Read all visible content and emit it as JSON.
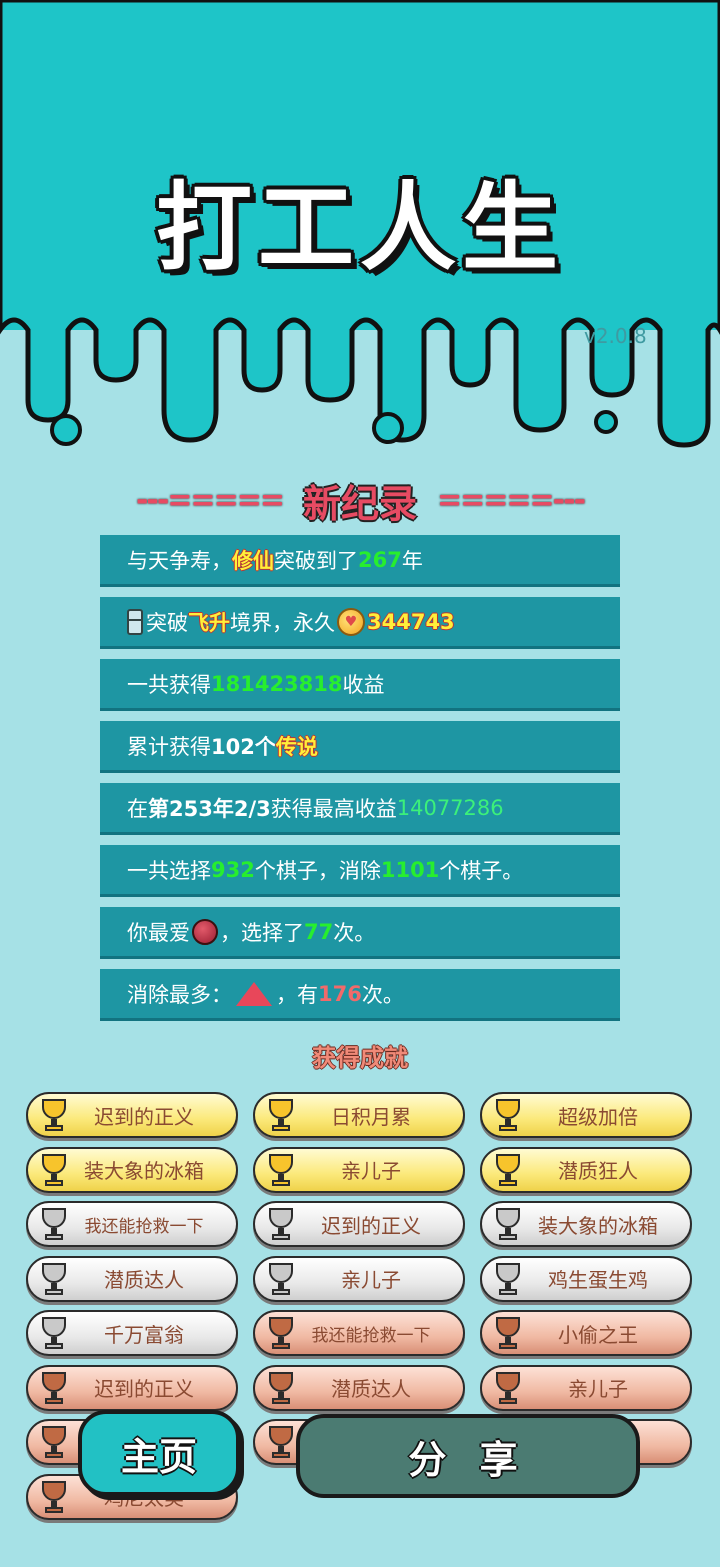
{
  "header": {
    "title": "打工人生",
    "version": "v2.0.8"
  },
  "record": {
    "label": "新纪录",
    "deco_left": "---=====",
    "deco_right": "=====---"
  },
  "stats": [
    {
      "parts": [
        "与天争寿，",
        "修仙",
        "突破到了",
        "267",
        "年"
      ]
    },
    {
      "parts": [
        "突破",
        "飞升",
        "境界，永久",
        "344743"
      ]
    },
    {
      "parts": [
        "一共获得",
        "181423818",
        "收益"
      ]
    },
    {
      "parts": [
        "累计获得",
        "102个",
        "传说"
      ]
    },
    {
      "parts": [
        "在 ",
        "第253年2/3",
        " 获得最高收益",
        "14077286"
      ]
    },
    {
      "parts": [
        "一共选择",
        "932",
        "个棋子，消除",
        "1101",
        "个棋子。"
      ]
    },
    {
      "parts": [
        "你最爱",
        "，选择了",
        "77",
        "次。"
      ]
    },
    {
      "parts": [
        "消除最多：",
        "，有",
        "176",
        "次。"
      ]
    }
  ],
  "achievements": {
    "title": "获得成就",
    "items": [
      {
        "label": "迟到的正义",
        "tier": "gold"
      },
      {
        "label": "日积月累",
        "tier": "gold"
      },
      {
        "label": "超级加倍",
        "tier": "gold"
      },
      {
        "label": "装大象的冰箱",
        "tier": "gold"
      },
      {
        "label": "亲儿子",
        "tier": "gold"
      },
      {
        "label": "潜质狂人",
        "tier": "gold"
      },
      {
        "label": "我还能抢救一下",
        "tier": "silver"
      },
      {
        "label": "迟到的正义",
        "tier": "silver"
      },
      {
        "label": "装大象的冰箱",
        "tier": "silver"
      },
      {
        "label": "潜质达人",
        "tier": "silver"
      },
      {
        "label": "亲儿子",
        "tier": "silver"
      },
      {
        "label": "鸡生蛋生鸡",
        "tier": "silver"
      },
      {
        "label": "千万富翁",
        "tier": "silver"
      },
      {
        "label": "我还能抢救一下",
        "tier": "bronze"
      },
      {
        "label": "小偷之王",
        "tier": "bronze"
      },
      {
        "label": "迟到的正义",
        "tier": "bronze"
      },
      {
        "label": "潜质达人",
        "tier": "bronze"
      },
      {
        "label": "亲儿子",
        "tier": "bronze"
      },
      {
        "label": "",
        "tier": "bronze"
      },
      {
        "label": "",
        "tier": "bronze"
      },
      {
        "label": "人",
        "tier": "bronze"
      },
      {
        "label": "鸡尼太美",
        "tier": "bronze"
      }
    ]
  },
  "buttons": {
    "home": "主页",
    "share": "分 享"
  },
  "icons": {
    "fridge": "fridge-icon",
    "coin": "coin-icon",
    "favorite": "lychee-icon",
    "most_eliminated": "watermelon-icon",
    "trophy": "trophy-icon"
  },
  "colors": {
    "header_bg": "#1ec5c8",
    "body_bg": "#a6e1e6",
    "row_bg": "#1e96a3",
    "highlight_green": "#27ee2e",
    "highlight_yellow": "#ffef3a",
    "accent_red": "#e74b63"
  }
}
